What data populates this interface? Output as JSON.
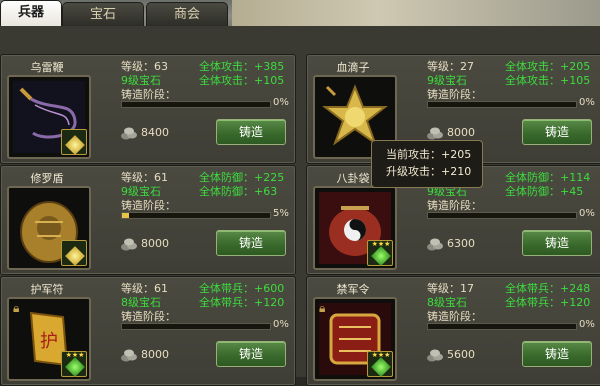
{
  "tabs": [
    {
      "label": "兵器",
      "active": true
    },
    {
      "label": "宝石",
      "active": false
    },
    {
      "label": "商会",
      "active": false
    }
  ],
  "cards": [
    {
      "name": "乌雷鞭",
      "level": "等级：63",
      "stat1": "全体攻击：",
      "stat1_val": "+385",
      "gem": "9级宝石",
      "stat2": "全体攻击：",
      "stat2_val": "+105",
      "stage": "铸造阶段：",
      "progress": 0,
      "pct": "0%",
      "cost": "8400",
      "button": "铸造",
      "gem_color": "yellow",
      "gem_stars": "",
      "lock": false,
      "art": "whip"
    },
    {
      "name": "血滴子",
      "level": "等级：27",
      "stat1": "全体攻击：",
      "stat1_val": "+205",
      "gem": "9级宝石",
      "stat2": "全体攻击：",
      "stat2_val": "+105",
      "stage": "铸造阶段：",
      "progress": 0,
      "pct": "0%",
      "cost": "8000",
      "button": "铸造",
      "gem_color": "none",
      "gem_stars": "",
      "lock": false,
      "art": "star"
    },
    {
      "name": "修罗盾",
      "level": "等级：61",
      "stat1": "全体防御：",
      "stat1_val": "+225",
      "gem": "9级宝石",
      "stat2": "全体防御：",
      "stat2_val": "+63",
      "stage": "铸造阶段：",
      "progress": 5,
      "pct": "5%",
      "cost": "8000",
      "button": "铸造",
      "gem_color": "yellow",
      "gem_stars": "",
      "lock": false,
      "art": "shield"
    },
    {
      "name": "八卦袋",
      "level": "等级：24",
      "stat1": "全体防御：",
      "stat1_val": "+114",
      "gem": "9级宝石",
      "stat2": "全体防御：",
      "stat2_val": "+45",
      "stage": "铸造阶段：",
      "progress": 0,
      "pct": "0%",
      "cost": "6300",
      "button": "铸造",
      "gem_color": "green",
      "gem_stars": "★★★",
      "lock": false,
      "art": "bag"
    },
    {
      "name": "护军符",
      "level": "等级：61",
      "stat1": "全体带兵：",
      "stat1_val": "+600",
      "gem": "8级宝石",
      "stat2": "全体带兵：",
      "stat2_val": "+120",
      "stage": "铸造阶段：",
      "progress": 0,
      "pct": "0%",
      "cost": "8000",
      "button": "铸造",
      "gem_color": "green",
      "gem_stars": "★★★",
      "lock": true,
      "art": "talisman"
    },
    {
      "name": "禁军令",
      "level": "等级：17",
      "stat1": "全体带兵：",
      "stat1_val": "+248",
      "gem": "8级宝石",
      "stat2": "全体带兵：",
      "stat2_val": "+120",
      "stage": "铸造阶段：",
      "progress": 0,
      "pct": "0%",
      "cost": "5600",
      "button": "铸造",
      "gem_color": "green",
      "gem_stars": "★★★",
      "lock": true,
      "art": "token"
    }
  ],
  "tooltip": {
    "line1": "当前攻击：+205",
    "line2": "升级攻击：+210"
  },
  "colors": {
    "stat_green": "#3ddc3d",
    "button_green": "#3a6a2c",
    "progress_yellow": "#e8c34a"
  }
}
